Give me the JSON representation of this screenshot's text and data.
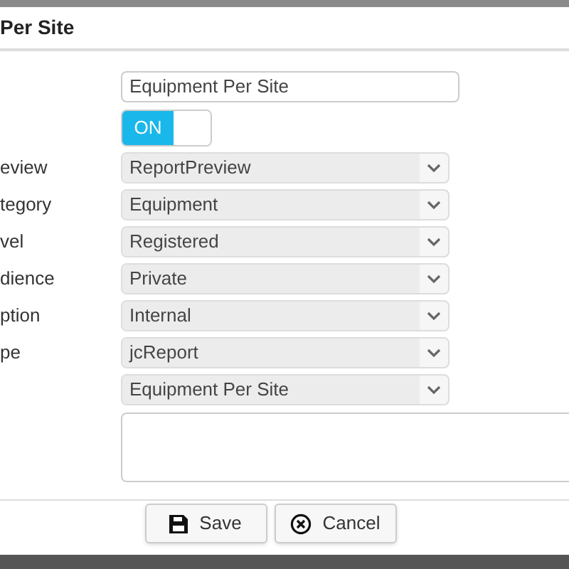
{
  "dialog": {
    "title": "Per Site"
  },
  "name_field": {
    "value": "Equipment Per Site"
  },
  "toggle": {
    "label": "ON",
    "on": true
  },
  "fields": [
    {
      "label": "eview",
      "value": "ReportPreview"
    },
    {
      "label": "tegory",
      "value": "Equipment"
    },
    {
      "label": "vel",
      "value": "Registered"
    },
    {
      "label": "dience",
      "value": "Private"
    },
    {
      "label": "ption",
      "value": "Internal"
    },
    {
      "label": "pe",
      "value": "jcReport"
    },
    {
      "value": "Equipment Per Site"
    }
  ],
  "buttons": [
    {
      "kind": "save",
      "label": "Save"
    },
    {
      "kind": "cancel",
      "label": "Cancel"
    }
  ]
}
